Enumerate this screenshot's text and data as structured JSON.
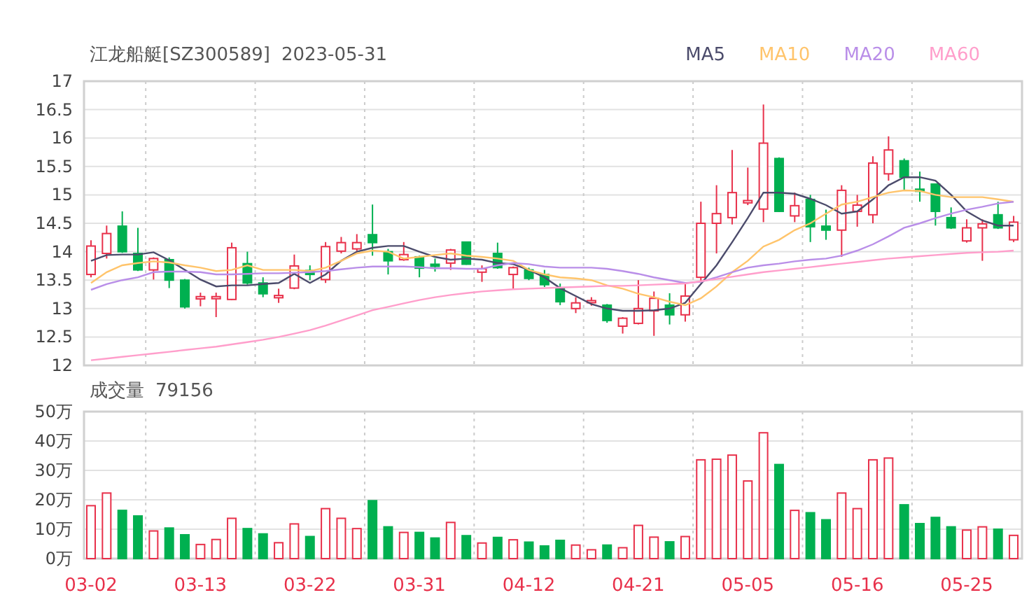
{
  "header": {
    "stock": "江龙船艇[SZ300589]",
    "date": "2023-05-31"
  },
  "price_chart": {
    "chart_data": {
      "type": "candlestick",
      "grid": true,
      "categories": [
        null,
        null,
        null,
        null,
        null,
        null,
        null,
        null,
        null,
        null,
        null,
        null,
        null,
        null,
        null,
        null,
        null,
        null,
        null,
        null,
        null,
        null,
        null,
        null,
        null,
        null,
        null,
        null,
        null,
        null,
        null,
        null,
        null,
        null,
        null,
        null,
        null,
        null,
        null,
        null,
        null,
        null,
        null,
        null,
        null,
        null,
        null,
        null,
        null,
        null,
        null,
        null,
        null,
        null,
        null,
        null,
        null,
        null,
        null,
        null
      ],
      "ylim": [
        12,
        17
      ],
      "yticks": [
        12,
        12.5,
        13,
        13.5,
        14,
        14.5,
        15,
        15.5,
        16,
        16.5,
        17
      ],
      "ohlc": [
        [
          13.6,
          14.2,
          13.55,
          14.1
        ],
        [
          13.97,
          14.46,
          13.88,
          14.32
        ],
        [
          14.45,
          14.71,
          13.98,
          14.0
        ],
        [
          13.97,
          14.42,
          13.66,
          13.68
        ],
        [
          13.68,
          13.9,
          13.51,
          13.88
        ],
        [
          13.86,
          13.9,
          13.36,
          13.5
        ],
        [
          13.5,
          13.52,
          13.0,
          13.03
        ],
        [
          13.17,
          13.28,
          13.04,
          13.21
        ],
        [
          13.18,
          13.28,
          12.85,
          13.21
        ],
        [
          13.16,
          14.16,
          13.15,
          14.07
        ],
        [
          13.79,
          14.0,
          13.42,
          13.45
        ],
        [
          13.45,
          13.55,
          13.2,
          13.26
        ],
        [
          13.19,
          13.35,
          13.1,
          13.23
        ],
        [
          13.36,
          13.95,
          13.34,
          13.75
        ],
        [
          13.67,
          13.76,
          13.5,
          13.6
        ],
        [
          13.51,
          14.17,
          13.45,
          14.09
        ],
        [
          14.01,
          14.26,
          13.97,
          14.16
        ],
        [
          14.05,
          14.31,
          14.01,
          14.16
        ],
        [
          14.3,
          14.83,
          13.93,
          14.16
        ],
        [
          14.0,
          14.05,
          13.6,
          13.84
        ],
        [
          13.86,
          14.17,
          13.84,
          13.95
        ],
        [
          13.91,
          13.93,
          13.55,
          13.71
        ],
        [
          13.78,
          13.88,
          13.65,
          13.75
        ],
        [
          13.8,
          14.05,
          13.68,
          14.03
        ],
        [
          14.17,
          14.18,
          13.77,
          13.78
        ],
        [
          13.64,
          13.76,
          13.47,
          13.7
        ],
        [
          13.97,
          14.16,
          13.7,
          13.72
        ],
        [
          13.6,
          13.74,
          13.33,
          13.72
        ],
        [
          13.68,
          13.72,
          13.5,
          13.53
        ],
        [
          13.6,
          13.68,
          13.38,
          13.42
        ],
        [
          13.36,
          13.44,
          13.06,
          13.12
        ],
        [
          13.0,
          13.2,
          12.92,
          13.1
        ],
        [
          13.12,
          13.2,
          13.05,
          13.14
        ],
        [
          13.06,
          13.08,
          12.75,
          12.79
        ],
        [
          12.69,
          12.85,
          12.56,
          12.83
        ],
        [
          12.74,
          13.5,
          12.72,
          13.0
        ],
        [
          12.96,
          13.3,
          12.52,
          13.18
        ],
        [
          13.06,
          13.27,
          12.72,
          12.89
        ],
        [
          12.89,
          13.43,
          12.77,
          13.22
        ],
        [
          13.55,
          14.88,
          13.47,
          14.5
        ],
        [
          14.5,
          15.17,
          13.97,
          14.67
        ],
        [
          14.6,
          15.79,
          14.48,
          15.04
        ],
        [
          14.86,
          15.48,
          14.82,
          14.9
        ],
        [
          14.75,
          16.59,
          14.52,
          15.91
        ],
        [
          15.64,
          15.66,
          14.7,
          14.71
        ],
        [
          14.63,
          15.04,
          14.52,
          14.81
        ],
        [
          14.92,
          15.0,
          14.17,
          14.44
        ],
        [
          14.45,
          14.74,
          14.21,
          14.38
        ],
        [
          14.38,
          15.17,
          13.91,
          15.08
        ],
        [
          14.71,
          15.0,
          14.44,
          14.82
        ],
        [
          14.65,
          15.68,
          14.5,
          15.56
        ],
        [
          15.37,
          16.03,
          15.25,
          15.79
        ],
        [
          15.6,
          15.64,
          15.08,
          15.31
        ],
        [
          15.1,
          15.41,
          14.88,
          15.07
        ],
        [
          15.19,
          15.2,
          14.46,
          14.71
        ],
        [
          14.6,
          14.78,
          14.4,
          14.42
        ],
        [
          14.19,
          14.57,
          14.16,
          14.42
        ],
        [
          14.42,
          14.57,
          13.84,
          14.49
        ],
        [
          14.65,
          14.88,
          14.4,
          14.42
        ],
        [
          14.21,
          14.63,
          14.17,
          14.52
        ]
      ]
    }
  },
  "moving_averages": {
    "chart_data": {
      "type": "line",
      "ylim": [
        12,
        17
      ],
      "categories": [
        null,
        null,
        null,
        null,
        null,
        null,
        null,
        null,
        null,
        null,
        null,
        null,
        null,
        null,
        null,
        null,
        null,
        null,
        null,
        null,
        null,
        null,
        null,
        null,
        null,
        null,
        null,
        null,
        null,
        null,
        null,
        null,
        null,
        null,
        null,
        null,
        null,
        null,
        null,
        null,
        null,
        null,
        null,
        null,
        null,
        null,
        null,
        null,
        null,
        null,
        null,
        null,
        null,
        null,
        null,
        null,
        null,
        null,
        null,
        null
      ],
      "series": [
        {
          "name": "MA5",
          "color": "#4b4b6b",
          "values": [
            13.84,
            13.94,
            13.95,
            13.95,
            13.99,
            13.85,
            13.68,
            13.51,
            13.39,
            13.41,
            13.41,
            13.43,
            13.45,
            13.61,
            13.45,
            13.6,
            13.84,
            14.0,
            14.07,
            14.1,
            14.1,
            14.0,
            13.91,
            13.86,
            13.88,
            13.86,
            13.8,
            13.78,
            13.68,
            13.55,
            13.36,
            13.22,
            13.08,
            13.0,
            12.96,
            12.96,
            12.97,
            13.0,
            13.1,
            13.43,
            13.76,
            14.17,
            14.59,
            15.04,
            15.04,
            15.02,
            14.93,
            14.82,
            14.67,
            14.71,
            14.92,
            15.17,
            15.31,
            15.31,
            15.25,
            15.0,
            14.71,
            14.55,
            14.46,
            14.46
          ]
        },
        {
          "name": "MA10",
          "color": "#ffc46b",
          "values": [
            13.45,
            13.64,
            13.76,
            13.8,
            13.83,
            13.81,
            13.76,
            13.72,
            13.66,
            13.68,
            13.76,
            13.68,
            13.68,
            13.68,
            13.66,
            13.72,
            13.84,
            13.97,
            14.02,
            14.0,
            13.88,
            13.91,
            13.94,
            13.97,
            13.93,
            13.91,
            13.88,
            13.84,
            13.68,
            13.6,
            13.55,
            13.53,
            13.5,
            13.41,
            13.35,
            13.26,
            13.2,
            13.12,
            13.06,
            13.18,
            13.39,
            13.64,
            13.84,
            14.09,
            14.21,
            14.38,
            14.5,
            14.67,
            14.83,
            14.88,
            14.96,
            15.04,
            15.08,
            15.07,
            15.0,
            14.96,
            14.96,
            14.96,
            14.92,
            14.88
          ]
        },
        {
          "name": "MA20",
          "color": "#b98ee8",
          "values": [
            13.33,
            13.43,
            13.5,
            13.55,
            13.64,
            13.65,
            13.65,
            13.64,
            13.6,
            13.6,
            13.61,
            13.62,
            13.62,
            13.63,
            13.64,
            13.66,
            13.69,
            13.72,
            13.74,
            13.74,
            13.74,
            13.73,
            13.71,
            13.71,
            13.7,
            13.7,
            13.76,
            13.8,
            13.78,
            13.74,
            13.72,
            13.72,
            13.72,
            13.7,
            13.66,
            13.61,
            13.55,
            13.5,
            13.45,
            13.47,
            13.55,
            13.64,
            13.72,
            13.76,
            13.79,
            13.83,
            13.86,
            13.88,
            13.93,
            14.02,
            14.13,
            14.27,
            14.42,
            14.5,
            14.59,
            14.67,
            14.74,
            14.79,
            14.85,
            14.88
          ]
        },
        {
          "name": "MA60",
          "color": "#ff9ecb",
          "values": [
            12.09,
            12.12,
            12.15,
            12.18,
            12.21,
            12.24,
            12.27,
            12.3,
            12.33,
            12.37,
            12.41,
            12.45,
            12.5,
            12.56,
            12.62,
            12.7,
            12.79,
            12.88,
            12.97,
            13.03,
            13.09,
            13.15,
            13.2,
            13.24,
            13.27,
            13.3,
            13.32,
            13.34,
            13.35,
            13.36,
            13.37,
            13.38,
            13.39,
            13.4,
            13.4,
            13.41,
            13.42,
            13.43,
            13.44,
            13.48,
            13.52,
            13.56,
            13.6,
            13.64,
            13.67,
            13.7,
            13.73,
            13.76,
            13.79,
            13.82,
            13.85,
            13.88,
            13.9,
            13.92,
            13.94,
            13.96,
            13.98,
            13.99,
            14.0,
            14.02
          ]
        }
      ]
    }
  },
  "volume_chart": {
    "label": "成交量",
    "value": "79156",
    "chart_data": {
      "type": "bar",
      "stacked": true,
      "grid": true,
      "categories": [
        "03-02",
        null,
        null,
        null,
        null,
        null,
        null,
        "03-13",
        null,
        null,
        null,
        null,
        null,
        null,
        "03-22",
        null,
        null,
        null,
        null,
        null,
        null,
        "03-31",
        null,
        null,
        null,
        null,
        null,
        null,
        "04-12",
        null,
        null,
        null,
        null,
        null,
        null,
        "04-21",
        null,
        null,
        null,
        null,
        null,
        null,
        "05-05",
        null,
        null,
        null,
        null,
        null,
        null,
        "05-16",
        null,
        null,
        null,
        null,
        null,
        null,
        "05-25",
        null,
        null,
        null
      ],
      "ylim": [
        0,
        50
      ],
      "yticks": [
        {
          "value": 0,
          "label": "0万"
        },
        {
          "value": 10,
          "label": "10万"
        },
        {
          "value": 20,
          "label": "20万"
        },
        {
          "value": 30,
          "label": "30万"
        },
        {
          "value": 40,
          "label": "40万"
        },
        {
          "value": 50,
          "label": "50万"
        }
      ],
      "series": [
        {
          "color": "#e8304a",
          "values": [
            18,
            22.3,
            null,
            null,
            9.4,
            null,
            null,
            4.8,
            6.5,
            13.7,
            null,
            null,
            5.4,
            11.8,
            null,
            17,
            13.7,
            10.2,
            null,
            null,
            8.9,
            null,
            null,
            12.3,
            null,
            5.3,
            null,
            6.4,
            null,
            null,
            null,
            4.6,
            3,
            null,
            3.7,
            11.3,
            7.3,
            null,
            7.5,
            33.6,
            33.8,
            35.2,
            26.4,
            42.8,
            null,
            16.4,
            null,
            null,
            22.3,
            17,
            33.6,
            34.2,
            null,
            null,
            null,
            null,
            9.7,
            10.8,
            null,
            7.9
          ]
        },
        {
          "color": "#00b050",
          "values": [
            null,
            null,
            16.4,
            14.5,
            null,
            10.4,
            8.1,
            null,
            null,
            null,
            10.2,
            8.4,
            null,
            null,
            7.5,
            null,
            null,
            null,
            19.7,
            10.8,
            null,
            8.9,
            7,
            null,
            7.8,
            null,
            7.2,
            null,
            5.6,
            4.3,
            6.2,
            null,
            null,
            4.6,
            null,
            null,
            null,
            5.7,
            null,
            null,
            null,
            null,
            null,
            null,
            32,
            null,
            15.6,
            13.2,
            null,
            null,
            null,
            null,
            18.3,
            11.9,
            14,
            10.8,
            null,
            null,
            10,
            null
          ]
        }
      ]
    }
  }
}
